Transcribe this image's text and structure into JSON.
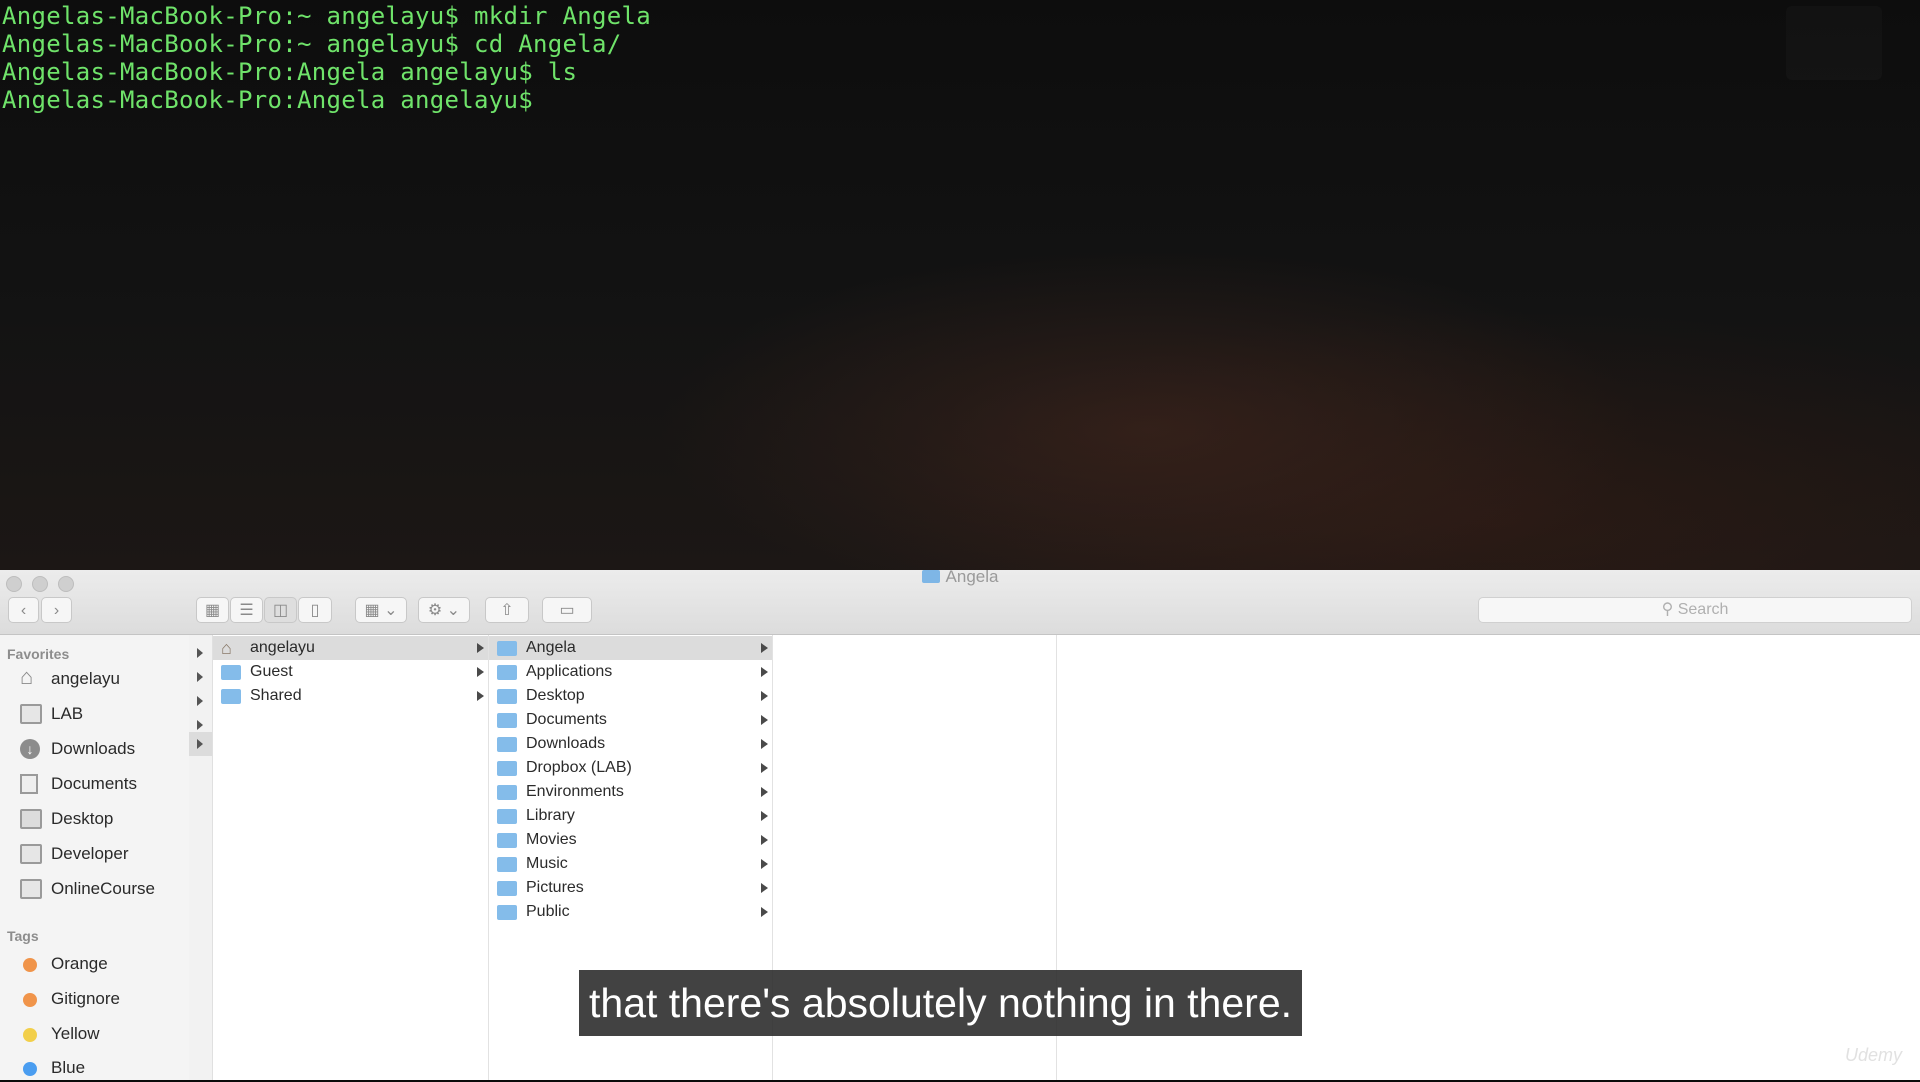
{
  "terminal": {
    "lines": [
      "Angelas-MacBook-Pro:~ angelayu$ mkdir Angela",
      "Angelas-MacBook-Pro:~ angelayu$ cd Angela/",
      "Angelas-MacBook-Pro:Angela angelayu$ ls",
      "Angelas-MacBook-Pro:Angela angelayu$"
    ],
    "text_color": "#6fe36a"
  },
  "finder": {
    "window_title": "Angela",
    "search_placeholder": "Search",
    "toolbar_icons": [
      "back-icon",
      "forward-icon",
      "icon-view-icon",
      "list-view-icon",
      "column-view-icon",
      "cover-flow-icon",
      "group-icon",
      "gear-icon",
      "share-icon",
      "tag-icon"
    ],
    "sidebar": {
      "favorites_heading": "Favorites",
      "favorites": [
        {
          "label": "angelayu",
          "icon": "home-icon"
        },
        {
          "label": "LAB",
          "icon": "folder-icon"
        },
        {
          "label": "Downloads",
          "icon": "downloads-icon"
        },
        {
          "label": "Documents",
          "icon": "documents-icon"
        },
        {
          "label": "Desktop",
          "icon": "desktop-icon"
        },
        {
          "label": "Developer",
          "icon": "folder-icon"
        },
        {
          "label": "OnlineCourse",
          "icon": "folder-icon"
        }
      ],
      "tags_heading": "Tags",
      "tags": [
        {
          "label": "Orange",
          "color": "#f0944a"
        },
        {
          "label": "Gitignore",
          "color": "#f0944a"
        },
        {
          "label": "Yellow",
          "color": "#f2cf4a"
        },
        {
          "label": "Blue",
          "color": "#4a9df0"
        }
      ]
    },
    "column1": [
      {
        "label": "angelayu",
        "selected": true
      },
      {
        "label": "Guest",
        "selected": false
      },
      {
        "label": "Shared",
        "selected": false
      }
    ],
    "column2": [
      {
        "label": "Angela",
        "selected": true
      },
      {
        "label": "Applications"
      },
      {
        "label": "Desktop"
      },
      {
        "label": "Documents"
      },
      {
        "label": "Downloads"
      },
      {
        "label": "Dropbox (LAB)"
      },
      {
        "label": "Environments"
      },
      {
        "label": "Library"
      },
      {
        "label": "Movies"
      },
      {
        "label": "Music"
      },
      {
        "label": "Pictures"
      },
      {
        "label": "Public"
      }
    ],
    "selection_color": "#dcdcdc",
    "folder_color": "#84bcea"
  },
  "subtitle": "that there's absolutely nothing in there.",
  "watermark": "Udemy"
}
